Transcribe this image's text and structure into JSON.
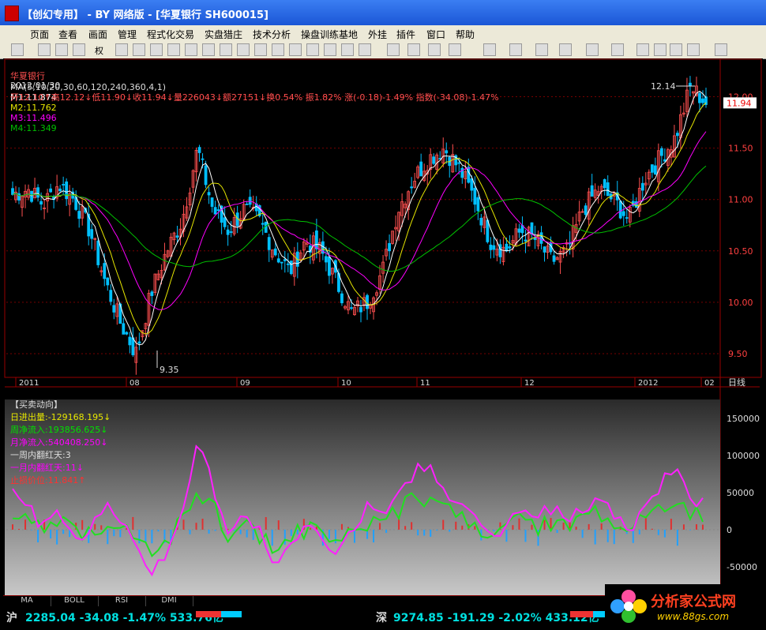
{
  "window": {
    "title": "【创幻专用】 - BY 网络版 - [华夏银行 SH600015]"
  },
  "menu": [
    "页面",
    "查看",
    "画面",
    "管理",
    "程式化交易",
    "实盘猎庄",
    "技术分析",
    "操盘训练基地",
    "外挂",
    "插件",
    "窗口",
    "帮助"
  ],
  "toolbar": {
    "quan_label": "权"
  },
  "stock_info": {
    "name": "华夏银行",
    "ma_params": "MA(5,10,20,30,60,120,240,360,4,1)",
    "m1": "M1:11.874",
    "m2": "M2:11.762",
    "m3": "M3:11.496",
    "m4": "M4:11.349"
  },
  "quote": {
    "date": "2012/01/30",
    "text": "开12.10↑高12.12↓低11.90↓收11.94↓量226043↓额27151↓换0.54% 振1.82% 涨(-0.18)-1.49% 指数(-34.08)-1.47%"
  },
  "price_axis": {
    "ticks": [
      "12.00",
      "11.50",
      "11.00",
      "10.50",
      "10.00",
      "9.50"
    ],
    "current": "11.94"
  },
  "price_annotations": {
    "high": "12.14",
    "low": "9.35"
  },
  "time_axis": {
    "labels": [
      "2011",
      "08",
      "09",
      "10",
      "11",
      "12",
      "2012",
      "02"
    ],
    "period": "日线"
  },
  "indicator": {
    "name": "【买卖动向】",
    "daily": "日进出量:-129168.195↓",
    "week": "周净流入:193856.625↓",
    "month": "月净流入:540408.250↓",
    "week_red": "一周内翻红天:3",
    "month_red": "一月内翻红天:11↓",
    "stop": "止损价位:11.841↑",
    "axis": [
      "150000",
      "100000",
      "50000",
      "0",
      "-50000"
    ]
  },
  "tabs": [
    "MA",
    "BOLL",
    "RSI",
    "DMI"
  ],
  "status": {
    "sh_label": "沪",
    "sh": "2285.04 -34.08 -1.47% 533.76亿",
    "sz_label": "深",
    "sz": "9274.85 -191.29 -2.02% 433.12亿"
  },
  "logo": {
    "name": "分析家公式网",
    "url": "www.88gs.com"
  },
  "colors": {
    "up": "#ff5050",
    "down": "#00c0ff",
    "white_line": "#ffffff",
    "yellow_line": "#e6e600",
    "magenta_line": "#ff00ff",
    "green_line": "#00c000"
  },
  "chart_data": {
    "type": "candlestick",
    "ylim": [
      9.3,
      12.25
    ],
    "x_labels": [
      "2011",
      "08",
      "09",
      "10",
      "11",
      "12",
      "2012",
      "02"
    ],
    "close_path": [
      11.05,
      11.1,
      10.95,
      11.15,
      11.0,
      10.7,
      10.2,
      9.8,
      9.5,
      10.1,
      10.5,
      10.8,
      11.5,
      10.9,
      10.7,
      10.9,
      10.8,
      10.5,
      10.3,
      10.6,
      10.5,
      10.2,
      9.9,
      10.0,
      10.3,
      10.9,
      11.2,
      11.4,
      11.5,
      11.3,
      11.0,
      10.6,
      10.5,
      10.7,
      10.6,
      10.4,
      10.5,
      10.9,
      11.1,
      11.0,
      10.8,
      11.2,
      11.4,
      11.6,
      12.1,
      11.94
    ],
    "wb_series": [
      0.7,
      0.6,
      0.5,
      0.6,
      0.45,
      0.5,
      0.6,
      0.55,
      0.4,
      0.3,
      0.4,
      0.6,
      0.9,
      0.7,
      0.5,
      0.6,
      0.5,
      0.35,
      0.4,
      0.55,
      0.45,
      0.4,
      0.5,
      0.6,
      0.55,
      0.7,
      0.75,
      0.8,
      0.7,
      0.6,
      0.55,
      0.5,
      0.5,
      0.6,
      0.55,
      0.6,
      0.55,
      0.6,
      0.65,
      0.55,
      0.5,
      0.6,
      0.7,
      0.8,
      0.65,
      0.6
    ]
  }
}
